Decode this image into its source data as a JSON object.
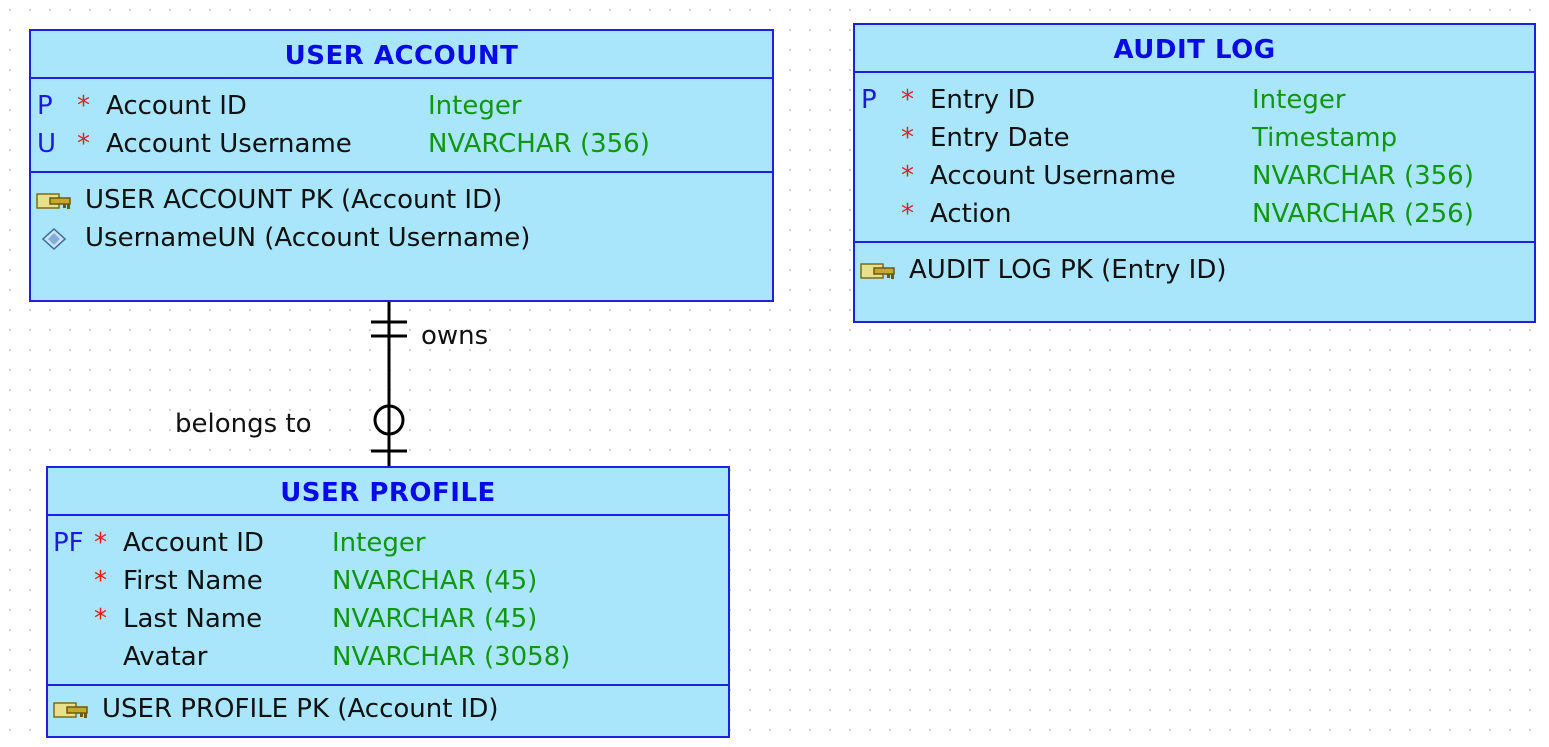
{
  "entities": {
    "user_account": {
      "title": "USER ACCOUNT",
      "attributes": [
        {
          "flag": "P",
          "mandatory": "*",
          "name": "Account ID",
          "type": "Integer"
        },
        {
          "flag": "U",
          "mandatory": "*",
          "name": "Account Username",
          "type": "NVARCHAR (356)"
        }
      ],
      "keys": [
        {
          "icon": "primary-key-icon",
          "label": "USER ACCOUNT PK (Account ID)"
        },
        {
          "icon": "unique-key-icon",
          "label": "UsernameUN (Account Username)"
        }
      ]
    },
    "audit_log": {
      "title": "AUDIT LOG",
      "attributes": [
        {
          "flag": "P",
          "mandatory": "*",
          "name": "Entry ID",
          "type": "Integer"
        },
        {
          "flag": "",
          "mandatory": "*",
          "name": "Entry Date",
          "type": "Timestamp"
        },
        {
          "flag": "",
          "mandatory": "*",
          "name": "Account Username",
          "type": "NVARCHAR (356)"
        },
        {
          "flag": "",
          "mandatory": "*",
          "name": "Action",
          "type": "NVARCHAR (256)"
        }
      ],
      "keys": [
        {
          "icon": "primary-key-icon",
          "label": "AUDIT LOG PK (Entry ID)"
        }
      ]
    },
    "user_profile": {
      "title": "USER PROFILE",
      "attributes": [
        {
          "flag": "PF",
          "mandatory": "*",
          "name": "Account ID",
          "type": "Integer"
        },
        {
          "flag": "",
          "mandatory": "*",
          "name": "First Name",
          "type": "NVARCHAR (45)"
        },
        {
          "flag": "",
          "mandatory": "*",
          "name": "Last Name",
          "type": "NVARCHAR (45)"
        },
        {
          "flag": "",
          "mandatory": "",
          "name": "Avatar",
          "type": "NVARCHAR (3058)"
        }
      ],
      "keys": [
        {
          "icon": "primary-key-icon",
          "label": "USER PROFILE PK (Account ID)"
        }
      ]
    }
  },
  "relationship": {
    "owns_label": "owns",
    "belongs_to_label": "belongs to"
  },
  "colors": {
    "entity_fill": "#a9e6fb",
    "entity_border": "#2020e0",
    "title_text": "#0a0ae6",
    "key_flag": "#1a1ae6",
    "mandatory_mark": "#e02020",
    "data_type": "#119611"
  }
}
